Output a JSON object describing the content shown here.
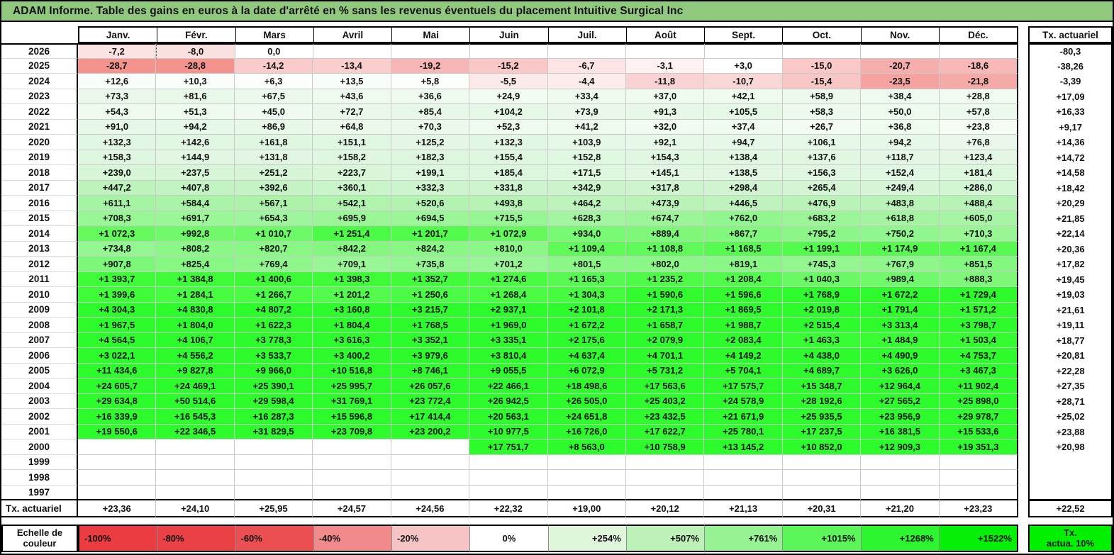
{
  "title": "ADAM Informe. Table des gains en euros à la date d'arrêté en % sans les revenus éventuels du placement Intuitive Surgical Inc",
  "colors": {
    "title_bg": "#90C97E",
    "grid_line": "#C9C9C9",
    "negative_knots": [
      [
        0,
        "#FFFFFF"
      ],
      [
        3,
        "#FDF1F1"
      ],
      [
        8,
        "#FBE0E0"
      ],
      [
        13,
        "#F9CFCF"
      ],
      [
        17,
        "#F8C0BF"
      ],
      [
        21,
        "#F6ADAC"
      ],
      [
        25,
        "#F59D99"
      ],
      [
        30,
        "#F48F89"
      ],
      [
        100,
        "#E93B40"
      ]
    ],
    "positive_knots": [
      [
        0,
        "#FFFFFF"
      ],
      [
        30,
        "#F1FBF1"
      ],
      [
        80,
        "#E8F8E9"
      ],
      [
        150,
        "#E0F7E1"
      ],
      [
        250,
        "#D6F5D6"
      ],
      [
        400,
        "#C5F3C4"
      ],
      [
        550,
        "#AEF3AC"
      ],
      [
        700,
        "#99F696"
      ],
      [
        850,
        "#84F780"
      ],
      [
        1000,
        "#70F96A"
      ],
      [
        1150,
        "#59FA52"
      ],
      [
        1300,
        "#46FC3F"
      ],
      [
        1500,
        "#35FC30"
      ],
      [
        1700,
        "#2EFB2B"
      ]
    ]
  },
  "table": {
    "columns": [
      "Janv.",
      "Févr.",
      "Mars",
      "Avril",
      "Mai",
      "Juin",
      "Juil.",
      "Août",
      "Sept.",
      "Oct.",
      "Nov.",
      "Déc."
    ],
    "tx_header": "Tx. actuariel",
    "rows": [
      {
        "year": "2026",
        "marker_col": 1,
        "cells": [
          "-7,2",
          "-8,0",
          "0,0",
          "",
          "",
          "",
          "",
          "",
          "",
          "",
          "",
          ""
        ],
        "tx": "-80,3"
      },
      {
        "year": "2025",
        "cells": [
          "-28,7",
          "-28,8",
          "-14,2",
          "-13,4",
          "-19,2",
          "-15,2",
          "-6,7",
          "-3,1",
          "+3,0",
          "-15,0",
          "-20,7",
          "-18,6"
        ],
        "tx": "-38,26"
      },
      {
        "year": "2024",
        "cells": [
          "+12,6",
          "+10,3",
          "+6,3",
          "+13,5",
          "+5,8",
          "-5,5",
          "-4,4",
          "-11,8",
          "-10,7",
          "-15,4",
          "-23,5",
          "-21,8"
        ],
        "tx": "-3,39"
      },
      {
        "year": "2023",
        "cells": [
          "+73,3",
          "+81,6",
          "+67,5",
          "+43,6",
          "+36,6",
          "+24,9",
          "+33,4",
          "+37,0",
          "+42,1",
          "+58,9",
          "+38,4",
          "+28,8"
        ],
        "tx": "+17,09"
      },
      {
        "year": "2022",
        "cells": [
          "+54,3",
          "+51,3",
          "+45,0",
          "+72,7",
          "+85,4",
          "+104,2",
          "+73,9",
          "+91,3",
          "+105,5",
          "+58,3",
          "+50,0",
          "+57,8"
        ],
        "tx": "+16,33"
      },
      {
        "year": "2021",
        "cells": [
          "+91,0",
          "+94,2",
          "+86,9",
          "+64,8",
          "+70,3",
          "+52,3",
          "+41,2",
          "+32,0",
          "+37,4",
          "+26,7",
          "+36,8",
          "+23,8"
        ],
        "tx": "+9,17"
      },
      {
        "year": "2020",
        "cells": [
          "+132,3",
          "+142,6",
          "+161,8",
          "+151,1",
          "+125,2",
          "+132,3",
          "+103,9",
          "+92,1",
          "+94,7",
          "+106,1",
          "+94,2",
          "+76,8"
        ],
        "tx": "+14,36"
      },
      {
        "year": "2019",
        "cells": [
          "+158,3",
          "+144,9",
          "+131,8",
          "+158,2",
          "+182,3",
          "+155,4",
          "+152,8",
          "+154,3",
          "+138,4",
          "+137,6",
          "+118,7",
          "+123,4"
        ],
        "tx": "+14,72"
      },
      {
        "year": "2018",
        "cells": [
          "+239,0",
          "+237,5",
          "+251,2",
          "+223,7",
          "+199,1",
          "+185,4",
          "+171,5",
          "+145,1",
          "+138,5",
          "+156,3",
          "+152,4",
          "+181,4"
        ],
        "tx": "+14,58"
      },
      {
        "year": "2017",
        "cells": [
          "+447,2",
          "+407,8",
          "+392,6",
          "+360,1",
          "+332,3",
          "+331,8",
          "+342,9",
          "+317,8",
          "+298,4",
          "+265,4",
          "+249,4",
          "+286,0"
        ],
        "tx": "+18,42"
      },
      {
        "year": "2016",
        "cells": [
          "+611,1",
          "+584,4",
          "+567,1",
          "+542,1",
          "+520,6",
          "+493,8",
          "+464,2",
          "+473,9",
          "+446,5",
          "+476,9",
          "+483,8",
          "+488,4"
        ],
        "tx": "+20,29"
      },
      {
        "year": "2015",
        "cells": [
          "+708,3",
          "+691,7",
          "+654,3",
          "+695,9",
          "+694,5",
          "+715,5",
          "+628,3",
          "+674,7",
          "+762,0",
          "+683,2",
          "+618,8",
          "+605,0"
        ],
        "tx": "+21,85"
      },
      {
        "year": "2014",
        "cells": [
          "+1 072,3",
          "+992,8",
          "+1 010,7",
          "+1 251,4",
          "+1 201,7",
          "+1 072,9",
          "+934,0",
          "+889,4",
          "+867,7",
          "+795,2",
          "+750,2",
          "+710,3"
        ],
        "tx": "+22,14"
      },
      {
        "year": "2013",
        "cells": [
          "+734,8",
          "+808,2",
          "+820,7",
          "+842,2",
          "+824,2",
          "+810,0",
          "+1 109,4",
          "+1 108,8",
          "+1 168,5",
          "+1 199,1",
          "+1 174,9",
          "+1 167,4"
        ],
        "tx": "+20,36"
      },
      {
        "year": "2012",
        "cells": [
          "+907,8",
          "+825,4",
          "+769,4",
          "+709,1",
          "+735,8",
          "+701,2",
          "+801,5",
          "+802,0",
          "+819,1",
          "+745,3",
          "+767,9",
          "+851,5"
        ],
        "tx": "+17,82"
      },
      {
        "year": "2011",
        "cells": [
          "+1 393,7",
          "+1 384,8",
          "+1 400,6",
          "+1 398,3",
          "+1 352,7",
          "+1 274,6",
          "+1 165,3",
          "+1 235,2",
          "+1 208,4",
          "+1 040,3",
          "+989,4",
          "+888,3"
        ],
        "tx": "+19,45"
      },
      {
        "year": "2010",
        "cells": [
          "+1 399,6",
          "+1 284,1",
          "+1 266,7",
          "+1 201,2",
          "+1 250,6",
          "+1 268,4",
          "+1 304,3",
          "+1 590,6",
          "+1 596,6",
          "+1 768,9",
          "+1 672,2",
          "+1 729,4"
        ],
        "tx": "+19,03"
      },
      {
        "year": "2009",
        "cells": [
          "+4 304,3",
          "+4 830,8",
          "+4 807,2",
          "+3 160,8",
          "+3 215,7",
          "+2 937,1",
          "+2 101,8",
          "+2 171,3",
          "+1 869,5",
          "+2 019,8",
          "+1 791,4",
          "+1 571,2"
        ],
        "tx": "+21,61"
      },
      {
        "year": "2008",
        "cells": [
          "+1 967,5",
          "+1 804,0",
          "+1 622,3",
          "+1 804,4",
          "+1 768,5",
          "+1 969,0",
          "+1 672,2",
          "+1 658,7",
          "+1 988,7",
          "+2 515,4",
          "+3 313,4",
          "+3 798,7"
        ],
        "tx": "+19,11"
      },
      {
        "year": "2007",
        "cells": [
          "+4 564,5",
          "+4 106,7",
          "+3 778,3",
          "+3 616,3",
          "+3 352,1",
          "+3 335,1",
          "+2 175,6",
          "+2 079,9",
          "+2 083,4",
          "+1 463,3",
          "+1 484,9",
          "+1 503,4"
        ],
        "tx": "+18,77"
      },
      {
        "year": "2006",
        "cells": [
          "+3 022,1",
          "+4 556,2",
          "+3 533,7",
          "+3 400,2",
          "+3 979,6",
          "+3 810,4",
          "+4 637,4",
          "+4 701,1",
          "+4 149,2",
          "+4 438,0",
          "+4 490,9",
          "+4 753,7"
        ],
        "tx": "+20,81"
      },
      {
        "year": "2005",
        "cells": [
          "+11 434,6",
          "+9 827,8",
          "+9 966,0",
          "+10 516,8",
          "+8 746,1",
          "+9 055,5",
          "+6 072,9",
          "+5 731,2",
          "+5 704,1",
          "+4 689,7",
          "+3 626,0",
          "+3 467,3"
        ],
        "tx": "+22,28"
      },
      {
        "year": "2004",
        "cells": [
          "+24 605,7",
          "+24 469,1",
          "+25 390,1",
          "+25 995,7",
          "+26 057,6",
          "+22 466,1",
          "+18 498,6",
          "+17 563,6",
          "+17 575,7",
          "+15 348,7",
          "+12 964,4",
          "+11 902,4"
        ],
        "tx": "+27,35"
      },
      {
        "year": "2003",
        "cells": [
          "+29 634,8",
          "+50 514,6",
          "+29 598,4",
          "+31 769,1",
          "+23 772,4",
          "+26 942,5",
          "+26 505,0",
          "+25 403,2",
          "+24 578,9",
          "+28 192,6",
          "+27 565,2",
          "+25 898,0"
        ],
        "tx": "+28,71"
      },
      {
        "year": "2002",
        "cells": [
          "+16 339,9",
          "+16 545,3",
          "+16 287,3",
          "+15 596,8",
          "+17 414,4",
          "+20 563,1",
          "+24 651,8",
          "+23 432,5",
          "+21 671,9",
          "+25 935,5",
          "+23 956,9",
          "+29 978,7"
        ],
        "tx": "+25,02"
      },
      {
        "year": "2001",
        "cells": [
          "+19 550,6",
          "+22 346,5",
          "+31 829,5",
          "+23 709,8",
          "+23 200,2",
          "+10 977,5",
          "+16 726,0",
          "+17 622,7",
          "+25 780,1",
          "+17 237,5",
          "+16 381,5",
          "+15 533,6"
        ],
        "tx": "+23,88"
      },
      {
        "year": "2000",
        "cells": [
          "",
          "",
          "",
          "",
          "",
          "+17 751,7",
          "+8 563,0",
          "+10 758,9",
          "+13 145,2",
          "+10 852,0",
          "+12 909,3",
          "+19 351,3"
        ],
        "tx": "+20,98"
      },
      {
        "year": "1999",
        "cells": [
          "",
          "",
          "",
          "",
          "",
          "",
          "",
          "",
          "",
          "",
          "",
          ""
        ],
        "tx": ""
      },
      {
        "year": "1998",
        "cells": [
          "",
          "",
          "",
          "",
          "",
          "",
          "",
          "",
          "",
          "",
          "",
          ""
        ],
        "tx": ""
      },
      {
        "year": "1997",
        "cells": [
          "",
          "",
          "",
          "",
          "",
          "",
          "",
          "",
          "",
          "",
          "",
          ""
        ],
        "tx": ""
      }
    ],
    "footer": {
      "label": "Tx. actuariel",
      "cells": [
        "+23,36",
        "+24,10",
        "+25,95",
        "+24,57",
        "+24,56",
        "+22,32",
        "+19,00",
        "+20,12",
        "+21,13",
        "+20,31",
        "+21,20",
        "+23,23"
      ],
      "tx": "+22,52"
    }
  },
  "scale": {
    "label_line1": "Echelle de",
    "label_line2": "couleur",
    "entries": [
      {
        "label": "-100%",
        "color": "#EA3C41",
        "align": "left"
      },
      {
        "label": "-80%",
        "color": "#EA4146",
        "align": "left"
      },
      {
        "label": "-60%",
        "color": "#EC4F52",
        "align": "left"
      },
      {
        "label": "-40%",
        "color": "#F18A8B",
        "align": "left"
      },
      {
        "label": "-20%",
        "color": "#F6C4C5",
        "align": "left"
      },
      {
        "label": "0%",
        "color": "#FFFFFF",
        "align": "center"
      },
      {
        "label": "+254%",
        "color": "#DFF6DB",
        "align": "right"
      },
      {
        "label": "+507%",
        "color": "#BEF0BA",
        "align": "right"
      },
      {
        "label": "+761%",
        "color": "#97F294",
        "align": "right"
      },
      {
        "label": "+1015%",
        "color": "#5CF65B",
        "align": "right"
      },
      {
        "label": "+1268%",
        "color": "#2DF52F",
        "align": "right"
      },
      {
        "label": "+1522%",
        "color": "#06EF06",
        "align": "right"
      }
    ],
    "tx_box_line1": "Tx.",
    "tx_box_line2": "actua. 10%",
    "tx_box_color": "#00F000"
  }
}
